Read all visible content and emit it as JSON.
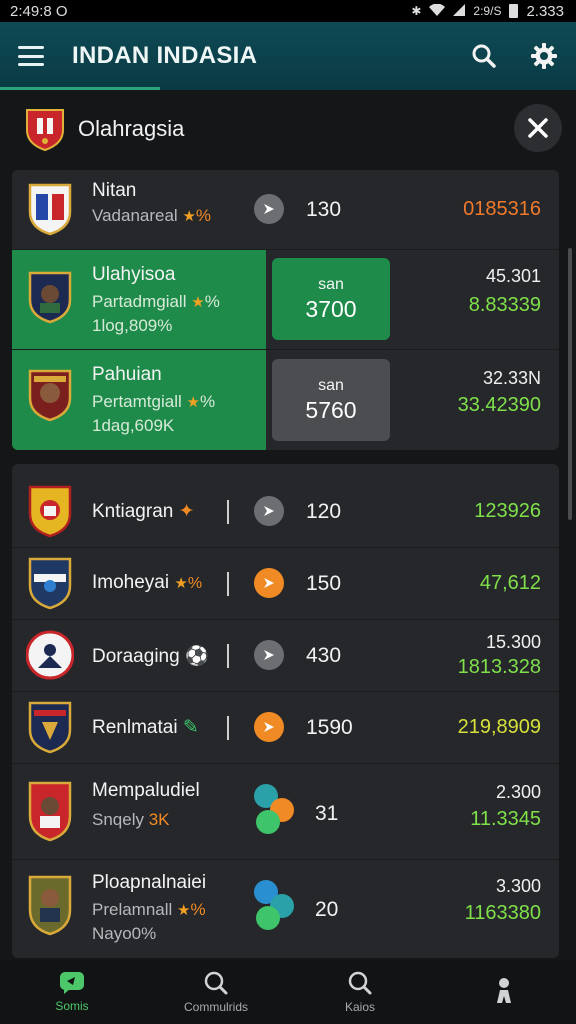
{
  "status_bar": {
    "left_text": "2:49:8 O",
    "right_text": "2:9/S",
    "clock": "2.333"
  },
  "app_bar": {
    "title": "INDAN INDASIA"
  },
  "league": {
    "name": "Olahragsia"
  },
  "top_rows": [
    {
      "name": "Nitan",
      "sub": "Vadanareal",
      "sub_rating": "%",
      "count": "130",
      "value": "0185316",
      "value_color": "#f07a2c"
    },
    {
      "name": "Ulahyisoa",
      "sub": "Partadmgiall",
      "sub_rating": "%",
      "sub2": "1log,809%",
      "box_label": "san",
      "box_value": "3700",
      "value_top": "45.301",
      "value": "8.83339",
      "value_color": "#7fe04a"
    },
    {
      "name": "Pahuian",
      "sub": "Pertamtgiall",
      "sub_rating": "%",
      "sub2": "1dag,609K",
      "box_label": "san",
      "box_value": "5760",
      "value_top": "32.33N",
      "value": "33.42390",
      "value_color": "#7fe04a"
    }
  ],
  "bottom_rows": [
    {
      "name": "Kntiagran",
      "count": "120",
      "value": "123926",
      "value_color": "#7fe04a"
    },
    {
      "name": "Imoheyai",
      "rating": "%",
      "count": "150",
      "value": "47,612",
      "value_color": "#7fe04a"
    },
    {
      "name": "Doraaging",
      "count": "430",
      "value_top": "15.300",
      "value": "1813.328",
      "value_color": "#7fe04a"
    },
    {
      "name": "Renlmatai",
      "count": "1590",
      "value": "219,8909",
      "value_color": "#d6e03a"
    },
    {
      "name": "Mempaludiel",
      "sub": "Snqely",
      "sub_rating": "3K",
      "count": "31",
      "value_top": "2.300",
      "value": "11.3345",
      "value_color": "#7fe04a"
    },
    {
      "name": "Ploapnalnaiei",
      "sub": "Prelamnall",
      "sub_rating": "%",
      "sub2": "Nayo0%",
      "count": "20",
      "value_top": "3.300",
      "value": "1163380",
      "value_color": "#7fe04a"
    }
  ],
  "bottom_nav": [
    {
      "label": "Somis"
    },
    {
      "label": "Commulrids"
    },
    {
      "label": "Kaios"
    },
    {
      "label": ""
    }
  ]
}
